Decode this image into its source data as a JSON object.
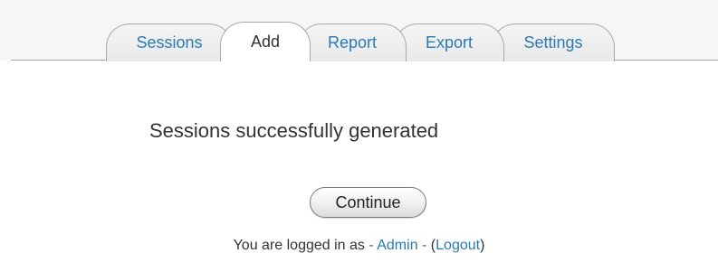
{
  "tabs": [
    {
      "label": "Sessions",
      "active": false
    },
    {
      "label": "Add",
      "active": true
    },
    {
      "label": "Report",
      "active": false
    },
    {
      "label": "Export",
      "active": false
    },
    {
      "label": "Settings",
      "active": false
    }
  ],
  "message": "Sessions successfully generated",
  "continue_label": "Continue",
  "footer": {
    "prefix": "You are logged in as ",
    "user_link": "- Admin -",
    "open_paren": " (",
    "logout_link": "Logout",
    "close_paren": ")"
  },
  "colors": {
    "link": "#2a7ab6",
    "text": "#333333",
    "tab_border": "#a9a9a9"
  }
}
